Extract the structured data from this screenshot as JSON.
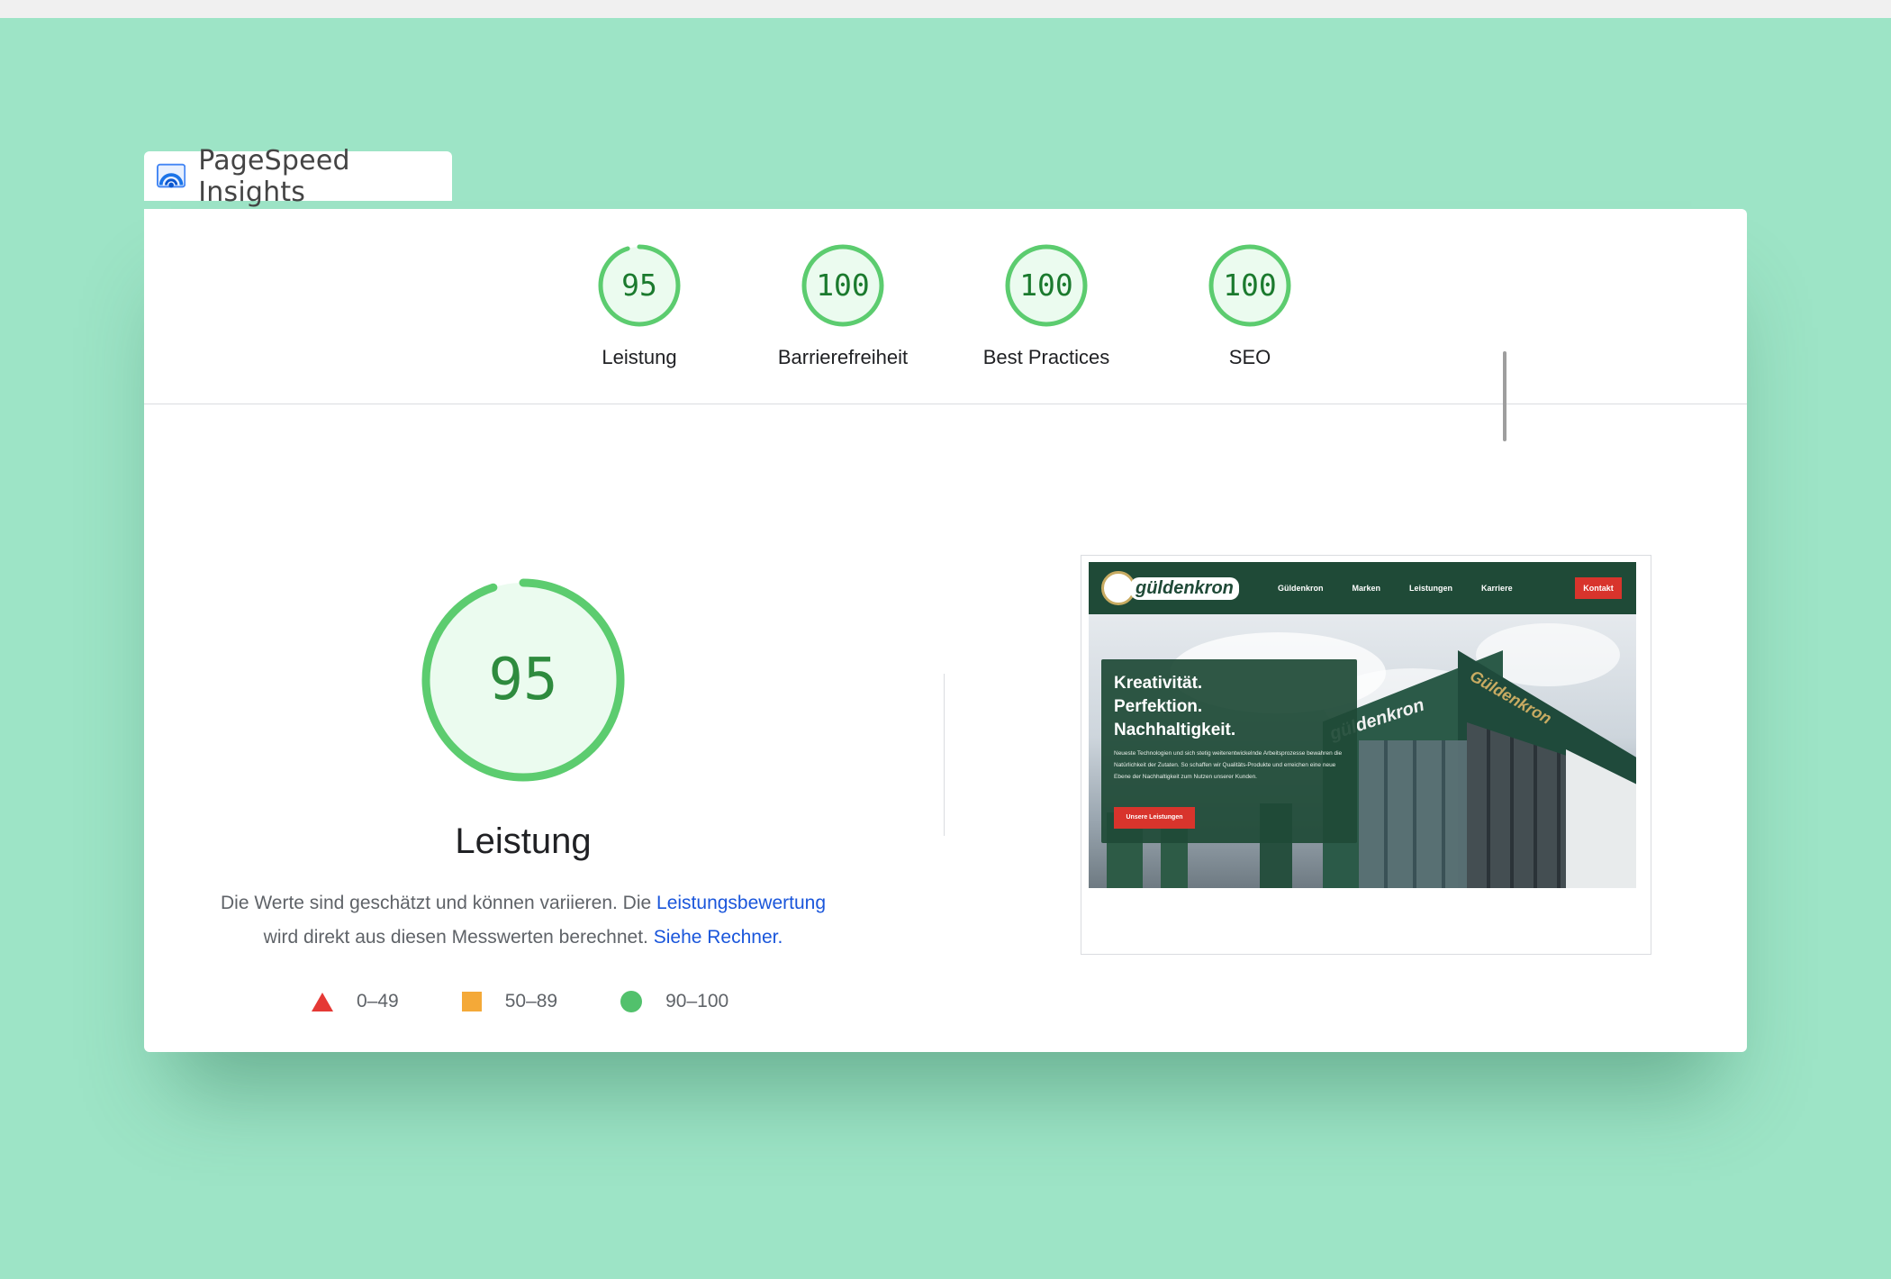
{
  "app": {
    "title": "PageSpeed Insights"
  },
  "categories": [
    {
      "label": "Leistung",
      "score": 95
    },
    {
      "label": "Barrierefreiheit",
      "score": 100
    },
    {
      "label": "Best Practices",
      "score": 100
    },
    {
      "label": "SEO",
      "score": 100
    }
  ],
  "main": {
    "score": 95,
    "title": "Leistung",
    "desc_part1": "Die Werte sind geschätzt und können variieren. Die ",
    "desc_link1": "Leistungsbewertung",
    "desc_part2": "wird direkt aus diesen Messwerten berechnet. ",
    "desc_link2": "Siehe Rechner."
  },
  "legend": [
    {
      "range": "0–49",
      "color": "#e53935"
    },
    {
      "range": "50–89",
      "color": "#f4a938"
    },
    {
      "range": "90–100",
      "color": "#52c16c"
    }
  ],
  "screenshot": {
    "brand": "güldenkron",
    "nav": [
      "Güldenkron",
      "Marken",
      "Leistungen",
      "Karriere"
    ],
    "cta": "Kontakt",
    "headline_1": "Kreativität.",
    "headline_2": "Perfektion.",
    "headline_3": "Nachhaltigkeit.",
    "body": "Neueste Technologien und sich stetig weiterentwickelnde Arbeitsprozesse bewahren die Natürlichkeit der Zutaten. So schaffen wir Qualitäts-Produkte und erreichen eine neue Ebene der Nachhaltigkeit zum Nutzen unserer Kunden.",
    "button": "Unsere Leistungen",
    "sign_front": "güldenkron",
    "sign_side": "Güldenkron"
  },
  "colors": {
    "pass": "#0cce6b",
    "pass_text": "#1b7a2e",
    "link": "#1a56db",
    "background": "#9de4c6"
  }
}
